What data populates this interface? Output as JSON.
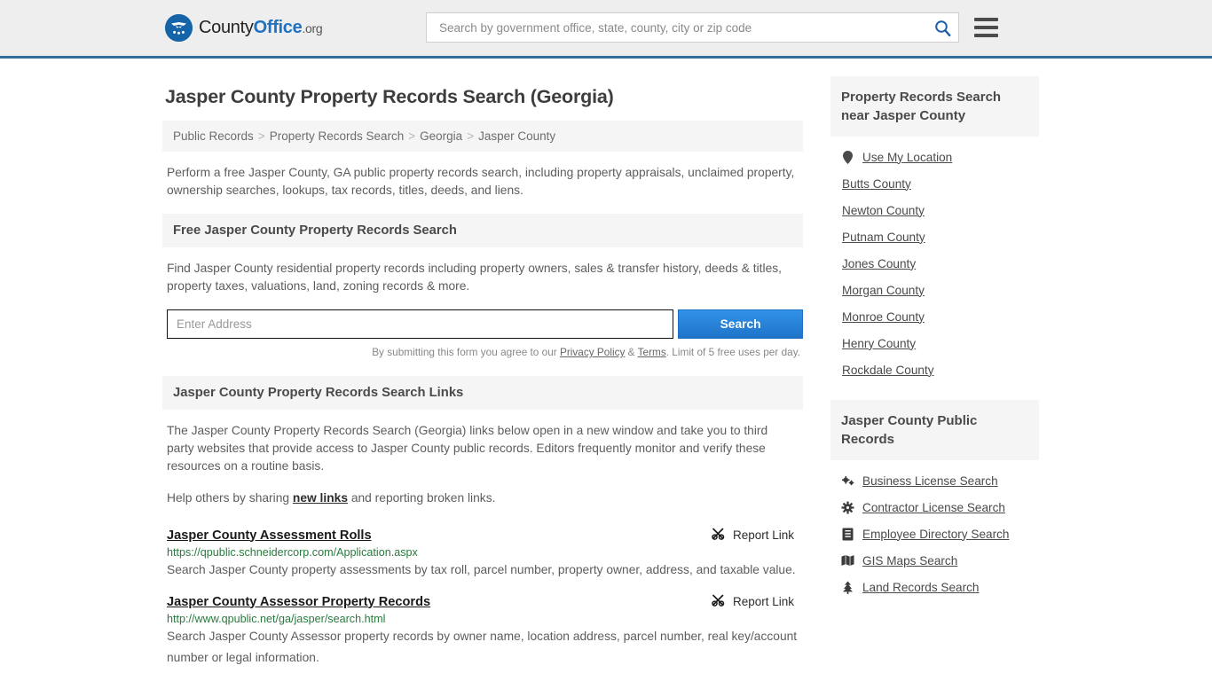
{
  "header": {
    "logo": {
      "name_part1": "County",
      "name_part2": "Office",
      "name_part3": ".org"
    },
    "search": {
      "placeholder": "Search by government office, state, county, city or zip code",
      "value": "",
      "icon": "search-icon"
    },
    "menu_icon": "hamburger-menu-icon"
  },
  "page": {
    "title": "Jasper County Property Records Search (Georgia)",
    "breadcrumb": [
      "Public Records",
      "Property Records Search",
      "Georgia",
      "Jasper County"
    ],
    "breadcrumb_separator": ">",
    "intro": "Perform a free Jasper County, GA public property records search, including property appraisals, unclaimed property, ownership searches, lookups, tax records, titles, deeds, and liens."
  },
  "free_search": {
    "heading": "Free Jasper County Property Records Search",
    "description": "Find Jasper County residential property records including property owners, sales & transfer history, deeds & titles, property taxes, valuations, land, zoning records & more.",
    "input_placeholder": "Enter Address",
    "input_value": "",
    "submit_label": "Search",
    "disclaimer_prefix": "By submitting this form you agree to our ",
    "privacy_label": "Privacy Policy",
    "disclaimer_amp": " & ",
    "terms_label": "Terms",
    "disclaimer_suffix": ". Limit of 5 free uses per day."
  },
  "links_section": {
    "heading": "Jasper County Property Records Search Links",
    "description": "The Jasper County Property Records Search (Georgia) links below open in a new window and take you to third party websites that provide access to Jasper County public records. Editors frequently monitor and verify these resources on a routine basis.",
    "help_prefix": "Help others by sharing ",
    "help_link_label": "new links",
    "help_suffix": " and reporting broken links.",
    "report_label": "Report Link",
    "report_icon": "unlink-icon",
    "results": [
      {
        "title": "Jasper County Assessment Rolls",
        "url": "https://qpublic.schneidercorp.com/Application.aspx",
        "description": "Search Jasper County property assessments by tax roll, parcel number, property owner, address, and taxable value."
      },
      {
        "title": "Jasper County Assessor Property Records",
        "url": "http://www.qpublic.net/ga/jasper/search.html",
        "description": "Search Jasper County Assessor property records by owner name, location address, parcel number, real key/account number or legal information."
      }
    ]
  },
  "sidebar": {
    "nearby": {
      "heading": "Property Records Search near Jasper County",
      "items": [
        {
          "label": "Use My Location",
          "icon": "map-pin-icon"
        },
        {
          "label": "Butts County",
          "icon": ""
        },
        {
          "label": "Newton County",
          "icon": ""
        },
        {
          "label": "Putnam County",
          "icon": ""
        },
        {
          "label": "Jones County",
          "icon": ""
        },
        {
          "label": "Morgan County",
          "icon": ""
        },
        {
          "label": "Monroe County",
          "icon": ""
        },
        {
          "label": "Henry County",
          "icon": ""
        },
        {
          "label": "Rockdale County",
          "icon": ""
        }
      ]
    },
    "public_records": {
      "heading": "Jasper County Public Records",
      "items": [
        {
          "label": "Business License Search",
          "icon": "cogs-icon"
        },
        {
          "label": "Contractor License Search",
          "icon": "cog-icon"
        },
        {
          "label": "Employee Directory Search",
          "icon": "id-card-icon"
        },
        {
          "label": "GIS Maps Search",
          "icon": "map-icon"
        },
        {
          "label": "Land Records Search",
          "icon": "tree-icon"
        }
      ]
    }
  },
  "colors": {
    "header_bg": "#eeeeee",
    "header_border": "#33709f",
    "brand_blue": "#1e72c4",
    "button_blue": "#2f8ae0",
    "url_green": "#2a7a3f",
    "section_bg": "#f5f5f5"
  }
}
